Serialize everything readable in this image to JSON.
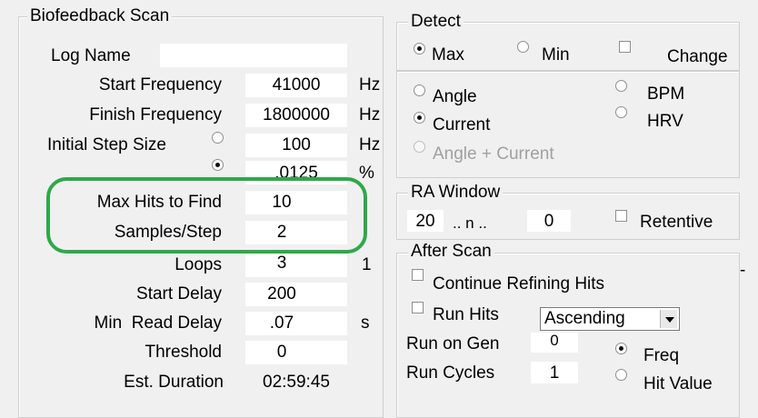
{
  "biofeedback": {
    "title": "Biofeedback Scan",
    "log_name_label": "Log Name",
    "log_name_value": "",
    "rows": {
      "start_frequency": {
        "label": "Start Frequency",
        "value": "41000",
        "unit": "Hz"
      },
      "finish_frequency": {
        "label": "Finish Frequency",
        "value": "1800000",
        "unit": "Hz"
      },
      "initial_step_size": {
        "label": "Initial Step Size",
        "value": "100",
        "unit": "Hz"
      },
      "step_percent": {
        "value": ".0125",
        "unit": "%"
      },
      "max_hits": {
        "label": "Max Hits to Find",
        "value": "10"
      },
      "samples_step": {
        "label": "Samples/Step",
        "value": "2"
      },
      "loops": {
        "label": "Loops",
        "value": "3",
        "extra": "1"
      },
      "start_delay": {
        "label": "Start Delay",
        "value": "200"
      },
      "min_read_delay": {
        "label": "Min  Read Delay",
        "value": ".07",
        "unit": "s"
      },
      "threshold": {
        "label": "Threshold",
        "value": "0"
      },
      "est_duration": {
        "label": "Est. Duration",
        "value": "02:59:45"
      }
    },
    "step_mode_selected": "percent"
  },
  "detect": {
    "title": "Detect",
    "max_label": "Max",
    "min_label": "Min",
    "change_label": "Change",
    "extreme_selected": "Max",
    "angle_label": "Angle",
    "current_label": "Current",
    "angle_current_label": "Angle + Current",
    "bpm_label": "BPM",
    "hrv_label": "HRV",
    "measure_selected": "Current"
  },
  "ra_window": {
    "title": "RA Window",
    "start_value": "20",
    "n_label": ".. n ..",
    "end_value": "0",
    "retentive_label": "Retentive"
  },
  "after_scan": {
    "title": "After Scan",
    "continue_refining_label": "Continue Refining Hits",
    "run_hits_label": "Run Hits",
    "order_selected": "Ascending",
    "run_on_gen_label": "Run on Gen",
    "run_on_gen_value": "0",
    "run_cycles_label": "Run Cycles",
    "run_cycles_value": "1",
    "freq_label": "Freq",
    "hit_value_label": "Hit Value",
    "sort_selected": "Freq"
  },
  "colors": {
    "highlight": "#2fa84a",
    "background": "#f0f0f0"
  }
}
